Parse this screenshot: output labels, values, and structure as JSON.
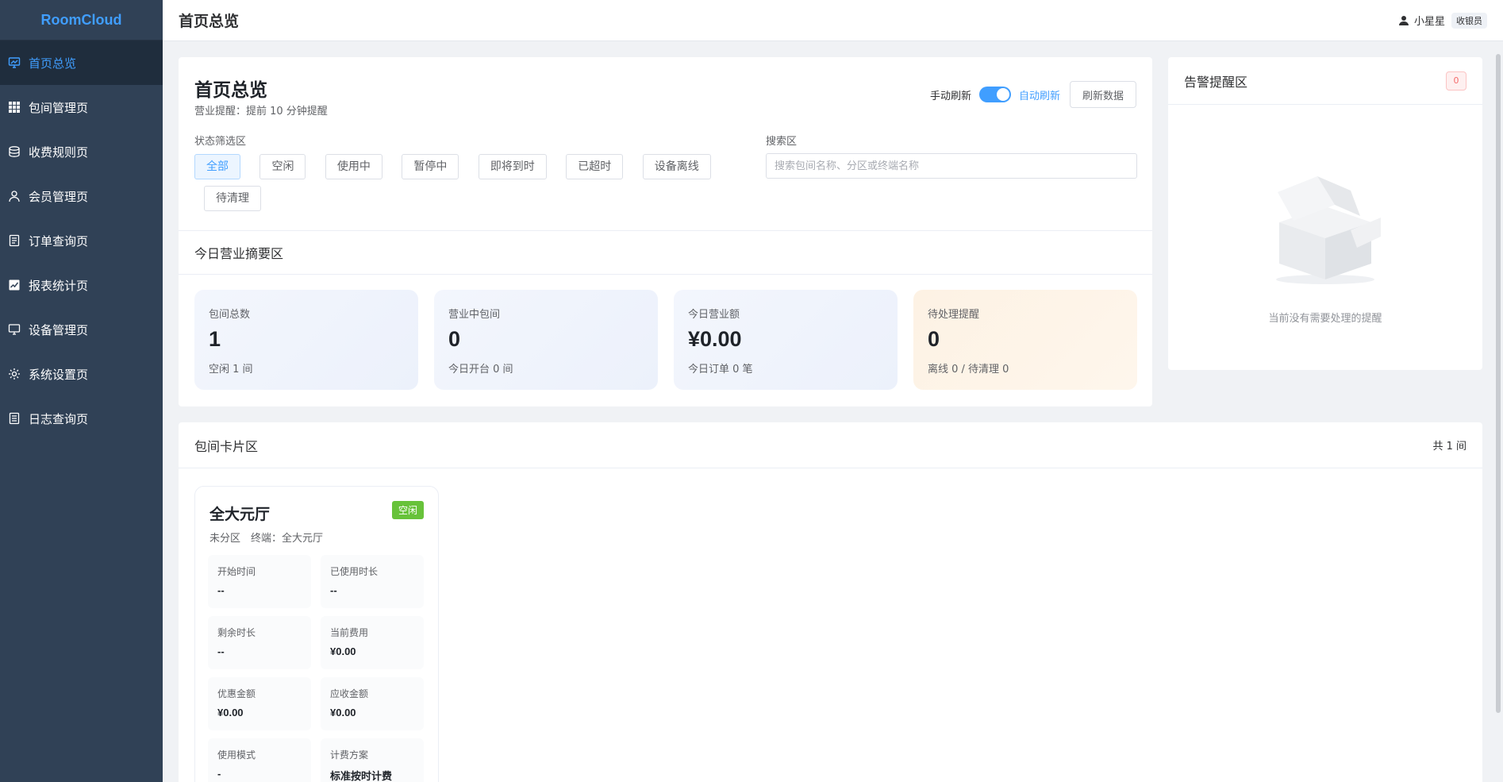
{
  "app": {
    "brand": "RoomCloud"
  },
  "sidebar": {
    "items": [
      {
        "label": "首页总览",
        "icon": "monitor-chart-icon",
        "active": true
      },
      {
        "label": "包间管理页",
        "icon": "grid-icon",
        "active": false
      },
      {
        "label": "收费规则页",
        "icon": "coins-icon",
        "active": false
      },
      {
        "label": "会员管理页",
        "icon": "user-icon",
        "active": false
      },
      {
        "label": "订单查询页",
        "icon": "document-icon",
        "active": false
      },
      {
        "label": "报表统计页",
        "icon": "chart-icon",
        "active": false
      },
      {
        "label": "设备管理页",
        "icon": "monitor-icon",
        "active": false
      },
      {
        "label": "系统设置页",
        "icon": "gear-icon",
        "active": false
      },
      {
        "label": "日志查询页",
        "icon": "log-icon",
        "active": false
      }
    ]
  },
  "header": {
    "title": "首页总览",
    "user_name": "小星星",
    "user_role": "收银员"
  },
  "overview": {
    "title": "首页总览",
    "subtitle": "营业提醒：提前 10 分钟提醒",
    "manual_refresh_label": "手动刷新",
    "auto_refresh_label": "自动刷新",
    "auto_refresh_on": true,
    "refresh_button": "刷新数据",
    "filter_label": "状态筛选区",
    "filters": [
      "全部",
      "空闲",
      "使用中",
      "暂停中",
      "即将到时",
      "已超时",
      "设备离线",
      "待清理"
    ],
    "active_filter": "全部",
    "search_label": "搜索区",
    "search_placeholder": "搜索包间名称、分区或终端名称",
    "search_value": ""
  },
  "summary": {
    "title": "今日营业摘要区",
    "cards": [
      {
        "label": "包间总数",
        "value": "1",
        "foot": "空闲 1 间",
        "tone": "blue"
      },
      {
        "label": "营业中包间",
        "value": "0",
        "foot": "今日开台 0 间",
        "tone": "blue"
      },
      {
        "label": "今日营业额",
        "value": "¥0.00",
        "foot": "今日订单 0 笔",
        "tone": "blue"
      },
      {
        "label": "待处理提醒",
        "value": "0",
        "foot": "离线 0 / 待清理 0",
        "tone": "orange"
      }
    ]
  },
  "alerts": {
    "title": "告警提醒区",
    "count": "0",
    "empty_text": "当前没有需要处理的提醒"
  },
  "rooms": {
    "title": "包间卡片区",
    "count_text": "共 1 间",
    "list": [
      {
        "name": "全大元厅",
        "status": "空闲",
        "meta": "未分区　终端：全大元厅",
        "fields": [
          {
            "label": "开始时间",
            "value": "--"
          },
          {
            "label": "已使用时长",
            "value": "--"
          },
          {
            "label": "剩余时长",
            "value": "--"
          },
          {
            "label": "当前费用",
            "value": "¥0.00"
          },
          {
            "label": "优惠金额",
            "value": "¥0.00"
          },
          {
            "label": "应收金额",
            "value": "¥0.00"
          },
          {
            "label": "使用模式",
            "value": "-"
          },
          {
            "label": "计费方案",
            "value": "标准按时计费"
          }
        ]
      }
    ]
  },
  "colors": {
    "sidebar_bg": "#304156",
    "accent": "#409eff",
    "status_idle": "#67c23a",
    "alert_red": "#f56c6c"
  }
}
